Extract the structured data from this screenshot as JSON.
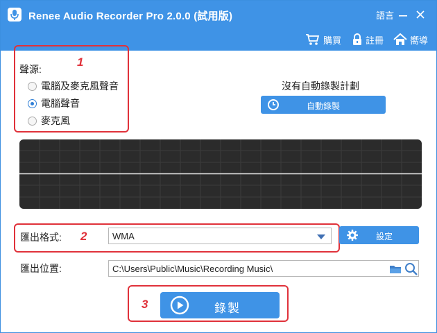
{
  "window": {
    "title": "Renee Audio Recorder Pro 2.0.0 (試用版)",
    "language_label": "語言"
  },
  "toolbar": {
    "buy_label": "購買",
    "register_label": "註冊",
    "guide_label": "嚮導"
  },
  "source": {
    "label": "聲源:",
    "options": [
      {
        "label": "電腦及麥克風聲音",
        "checked": false
      },
      {
        "label": "電腦聲音",
        "checked": true
      },
      {
        "label": "麥克風",
        "checked": false
      }
    ]
  },
  "schedule": {
    "status_text": "沒有自動錄製計劃",
    "auto_record_label": "自動錄製"
  },
  "format": {
    "label": "匯出格式:",
    "selected": "WMA",
    "settings_label": "設定"
  },
  "output": {
    "label": "匯出位置:",
    "path": "C:\\Users\\Public\\Music\\Recording Music\\"
  },
  "record": {
    "label": "錄製"
  },
  "annotations": {
    "step1": "1",
    "step2": "2",
    "step3": "3"
  },
  "colors": {
    "accent": "#3f93e6",
    "highlight": "#e0313a",
    "waveform_bg": "#2b2b2b"
  }
}
